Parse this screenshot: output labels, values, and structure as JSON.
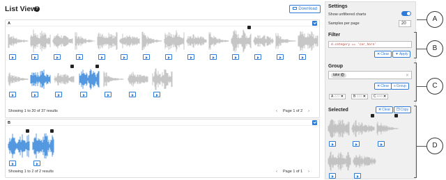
{
  "list_view": {
    "title": "List View",
    "help_icon": "question-circle-icon",
    "download_label": "Download",
    "download_icon": "download-icon"
  },
  "panel_a": {
    "label": "A",
    "footer": "Showing 1 to 20 of 37 results",
    "page": "Page 1 of 2",
    "prev": "‹",
    "next": "›"
  },
  "panel_b": {
    "label": "B",
    "footer": "Showing 1 to 2 of 2 results",
    "page": "Page 1 of 1",
    "prev": "‹",
    "next": "›"
  },
  "settings": {
    "title": "Settings",
    "show_unfiltered_label": "Show unfiltered charts",
    "show_unfiltered": true,
    "samples_label": "Samples per page",
    "samples_value": "20"
  },
  "filter": {
    "title": "Filter",
    "expression": "d.category == 'car_horn'",
    "clear_label": "Clear",
    "apply_label": "Apply"
  },
  "group": {
    "title": "Group",
    "tag": "take",
    "clear_label": "Clear",
    "group_label": "Group",
    "chips": [
      {
        "letter": "A",
        "value": "222"
      },
      {
        "letter": "B",
        "value": "333"
      },
      {
        "letter": "C",
        "value": "444"
      }
    ]
  },
  "selected": {
    "title": "Selected",
    "clear_label": "Clear",
    "copy_label": "Copy"
  },
  "annotations": [
    "A",
    "B",
    "C",
    "D"
  ],
  "colors": {
    "accent": "#2d7bd6",
    "waveform_gray": "#b8b8b8",
    "waveform_blue": "#2a7fd8"
  }
}
